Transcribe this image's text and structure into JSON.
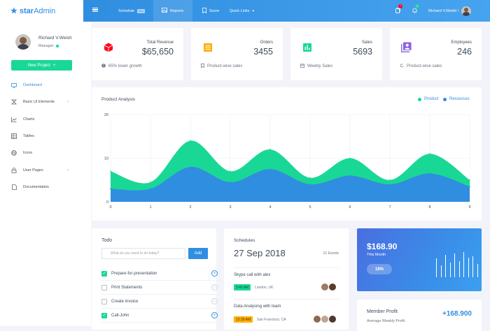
{
  "brand": {
    "name_bold": "star",
    "name_thin": "Admin"
  },
  "profile": {
    "name": "Richard V.Welsh",
    "role": "Manager"
  },
  "new_project_label": "New Project",
  "sidebar": {
    "items": [
      {
        "label": "Dashboard",
        "icon": "monitor-icon"
      },
      {
        "label": "Basic UI Elements",
        "icon": "layers-icon"
      },
      {
        "label": "Charts",
        "icon": "chart-line-icon"
      },
      {
        "label": "Tables",
        "icon": "table-icon"
      },
      {
        "label": "Icons",
        "icon": "globe-icon"
      },
      {
        "label": "User Pages",
        "icon": "lock-icon"
      },
      {
        "label": "Documentation",
        "icon": "file-icon"
      }
    ]
  },
  "topbar": {
    "schedule_label": "Schedule",
    "new_badge": "New",
    "reports_label": "Reports",
    "score_label": "Score",
    "quicklinks_label": "Quick Links",
    "copy_badge": "7",
    "bell_badge": "4",
    "user_name": "Richard V.Welsh !"
  },
  "stats": [
    {
      "label": "Total Revenue",
      "value": "$65,650",
      "foot": "65% lower growth",
      "color": "#ff0017",
      "icon": "cube-icon",
      "foot_icon": "alert-circle-icon"
    },
    {
      "label": "Orders",
      "value": "3455",
      "foot": "Product-wise sales",
      "color": "#ffaf00",
      "icon": "receipt-icon",
      "foot_icon": "bookmark-icon"
    },
    {
      "label": "Sales",
      "value": "5693",
      "foot": "Weekly Sales",
      "color": "#19d895",
      "icon": "poll-box-icon",
      "foot_icon": "calendar-icon"
    },
    {
      "label": "Employees",
      "value": "246",
      "foot": "Product-wise sales",
      "color": "#8862e0",
      "icon": "account-box-icon",
      "foot_icon": "reload-icon"
    }
  ],
  "chart_title": "Product Analysis",
  "chart_data": {
    "type": "area",
    "x": [
      0,
      1,
      2,
      3,
      4,
      5,
      6,
      7,
      8,
      9
    ],
    "series": [
      {
        "name": "Product",
        "values": [
          7,
          4.5,
          14,
          7,
          12,
          5.5,
          10,
          5,
          11,
          5
        ]
      },
      {
        "name": "Resources",
        "values": [
          3,
          3,
          8,
          4.5,
          7.5,
          4,
          6,
          4,
          6.5,
          3.5
        ]
      }
    ],
    "ylim": [
      0,
      20
    ],
    "yticks": [
      0,
      10,
      20
    ],
    "colors": {
      "Product": "#19d895",
      "Resources": "#308ee0"
    },
    "legend": "top-right",
    "grid": true
  },
  "todo": {
    "title": "Todo",
    "placeholder": "What do you need to do today?",
    "add_label": "Add",
    "items": [
      {
        "text": "Prepare-for-presentation",
        "done": true
      },
      {
        "text": "Print Statements",
        "done": false
      },
      {
        "text": "Create invoice",
        "done": false
      },
      {
        "text": "Call-John",
        "done": true
      }
    ]
  },
  "schedules": {
    "title": "Schedules",
    "date": "27 Sep 2018",
    "events_count": "21 Events",
    "events": [
      {
        "title": "Skype call with alex",
        "time": "3:45 AM",
        "place": "London, UK",
        "time_color": "#19d895"
      },
      {
        "title": "Data Analysing with team",
        "time": "12:30 AM",
        "place": "San Francisco, CA",
        "time_color": "#ffaf00"
      }
    ]
  },
  "month_card": {
    "value": "$168.90",
    "label": "This Month",
    "pill": "18%",
    "bars": [
      0.7,
      0.45,
      0.85,
      0.55,
      0.9,
      0.6,
      0.95,
      0.75,
      0.8,
      0.5
    ]
  },
  "member_profit": {
    "title": "Member Profit",
    "sub": "Average Weekly Profit",
    "value": "+168.900"
  }
}
